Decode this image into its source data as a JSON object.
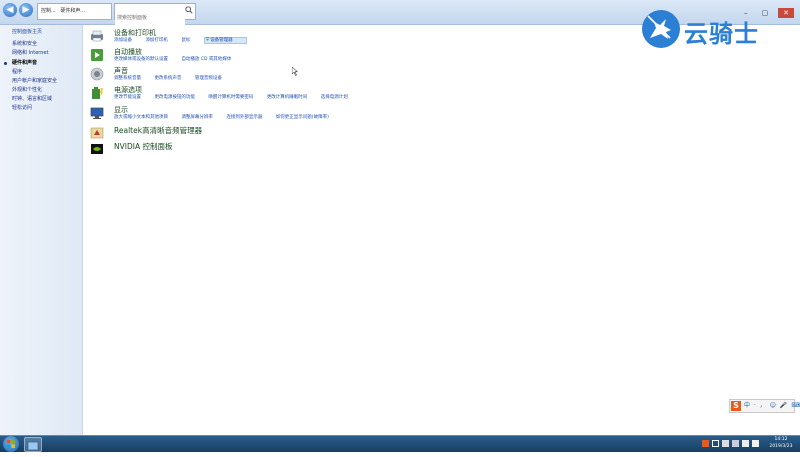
{
  "address_bar": {
    "breadcrumbs": [
      "控制...",
      "硬件和声..."
    ],
    "search_placeholder": "搜索控制面板"
  },
  "sidebar": {
    "home": "控制面板主页",
    "items": [
      {
        "label": "系统和安全",
        "current": false
      },
      {
        "label": "网络和 Internet",
        "current": false
      },
      {
        "label": "硬件和声音",
        "current": true
      },
      {
        "label": "程序",
        "current": false
      },
      {
        "label": "用户帐户和家庭安全",
        "current": false
      },
      {
        "label": "外观和个性化",
        "current": false
      },
      {
        "label": "时钟、语言和区域",
        "current": false
      },
      {
        "label": "轻松访问",
        "current": false
      }
    ]
  },
  "categories": [
    {
      "title": "设备和打印机",
      "links": [
        "添加设备",
        "添加打印机",
        "鼠标",
        "设备管理器"
      ],
      "highlighted_link": 3
    },
    {
      "title": "自动播放",
      "links": [
        "更改媒体或设备的默认设置",
        "自动播放 CD 或其他媒体"
      ]
    },
    {
      "title": "声音",
      "links": [
        "调整系统音量",
        "更改系统声音",
        "管理音频设备"
      ]
    },
    {
      "title": "电源选项",
      "links": [
        "更改节能设置",
        "更改电源按钮的功能",
        "唤醒计算机时需要密码",
        "更改计算机睡眠时间",
        "选择电源计划"
      ]
    },
    {
      "title": "显示",
      "links": [
        "放大或缩小文本和其他项目",
        "调整屏幕分辨率",
        "连接到外部显示器",
        "如何更正显示问题(故障率)"
      ]
    },
    {
      "title": "Realtek高清晰音频管理器",
      "links": []
    },
    {
      "title": "NVIDIA 控制面板",
      "links": []
    }
  ],
  "watermark": {
    "text": "云骑士"
  },
  "ime": {
    "logo": "S",
    "items": [
      "中",
      "·",
      "，",
      "☺",
      "🎤",
      "⌨",
      "👕",
      "▦"
    ]
  },
  "taskbar": {
    "time": "14:12",
    "date": "2019/3/23"
  },
  "colors": {
    "link": "#1e4fb3",
    "title": "#1a4a20",
    "logo": "#2b7fd4",
    "taskbar": "#1f4b74"
  }
}
